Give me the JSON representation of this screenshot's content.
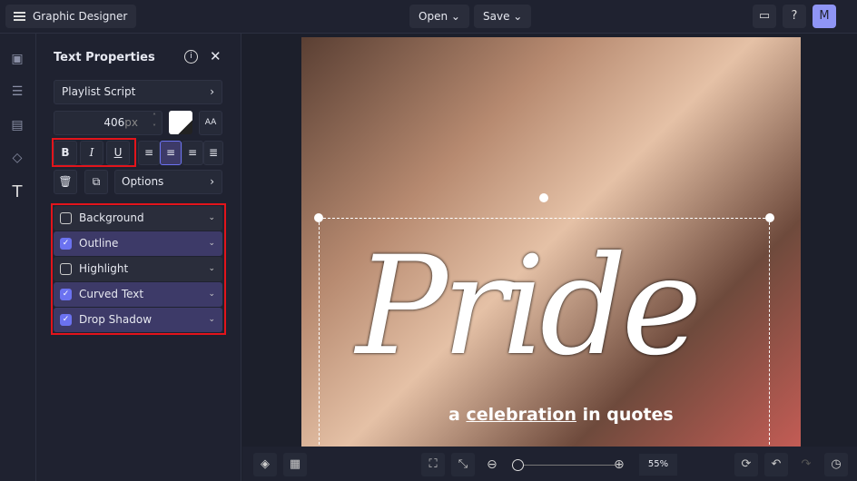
{
  "header": {
    "app_title": "Graphic Designer",
    "open_label": "Open",
    "save_label": "Save",
    "avatar_initial": "M"
  },
  "panel": {
    "title": "Text Properties",
    "font": "Playlist Script",
    "font_size": "406",
    "font_unit": "px",
    "text_color": "#ffffff",
    "bold": "B",
    "italic": "I",
    "underline": "U",
    "options_label": "Options",
    "effects": [
      {
        "label": "Background",
        "checked": false
      },
      {
        "label": "Outline",
        "checked": true
      },
      {
        "label": "Highlight",
        "checked": false
      },
      {
        "label": "Curved Text",
        "checked": true
      },
      {
        "label": "Drop Shadow",
        "checked": true
      }
    ]
  },
  "canvas": {
    "headline": "Pride",
    "subtitle_a": "a",
    "subtitle_b": "celebration",
    "subtitle_c": "in",
    "subtitle_d": "quotes"
  },
  "footer": {
    "zoom": "55%",
    "zoom_fraction": 0.1
  }
}
